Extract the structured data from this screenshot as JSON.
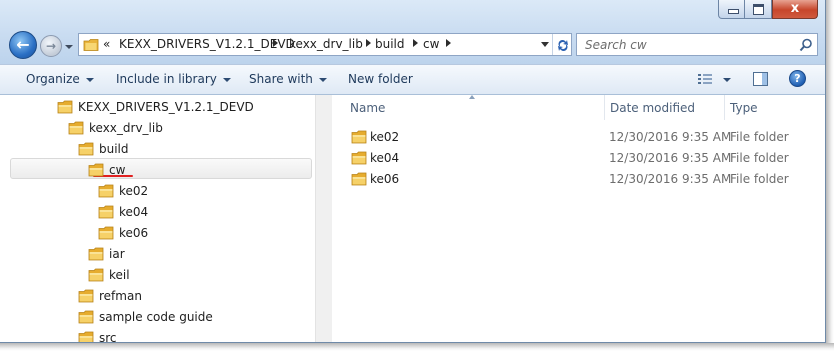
{
  "window": {
    "caption_buttons": {
      "close_glyph": "x"
    }
  },
  "nav": {
    "back_glyph": "←",
    "forward_glyph": "→",
    "back_icon": "back-arrow-icon",
    "forward_icon": "forward-arrow-icon"
  },
  "address": {
    "overflow_glyph": "«",
    "breadcrumbs": [
      "KEXX_DRIVERS_V1.2.1_DEVD",
      "kexx_drv_lib",
      "build",
      "cw"
    ],
    "refresh_icon": "refresh-icon"
  },
  "search": {
    "placeholder": "Search cw",
    "value": ""
  },
  "toolbar": {
    "organize": "Organize",
    "include_in_library": "Include in library",
    "share_with": "Share with",
    "new_folder": "New folder",
    "help_glyph": "?"
  },
  "tree": [
    {
      "label": "KEXX_DRIVERS_V1.2.1_DEVD",
      "selected": false
    },
    {
      "label": "kexx_drv_lib",
      "selected": false
    },
    {
      "label": "build",
      "selected": false
    },
    {
      "label": "cw",
      "selected": true
    },
    {
      "label": "ke02",
      "selected": false
    },
    {
      "label": "ke04",
      "selected": false
    },
    {
      "label": "ke06",
      "selected": false
    },
    {
      "label": "iar",
      "selected": false
    },
    {
      "label": "keil",
      "selected": false
    },
    {
      "label": "refman",
      "selected": false
    },
    {
      "label": "sample code guide",
      "selected": false
    },
    {
      "label": "src",
      "selected": false
    }
  ],
  "list": {
    "columns": {
      "name": "Name",
      "date_modified": "Date modified",
      "type": "Type"
    },
    "rows": [
      {
        "name": "ke02",
        "date": "12/30/2016 9:35 AM",
        "type": "File folder"
      },
      {
        "name": "ke04",
        "date": "12/30/2016 9:35 AM",
        "type": "File folder"
      },
      {
        "name": "ke06",
        "date": "12/30/2016 9:35 AM",
        "type": "File folder"
      }
    ]
  },
  "colors": {
    "titlebar": "#c9dcf1",
    "folder": "#f2c94c",
    "annotation_underline": "#e02020",
    "toolbar_text": "#1e395b"
  }
}
